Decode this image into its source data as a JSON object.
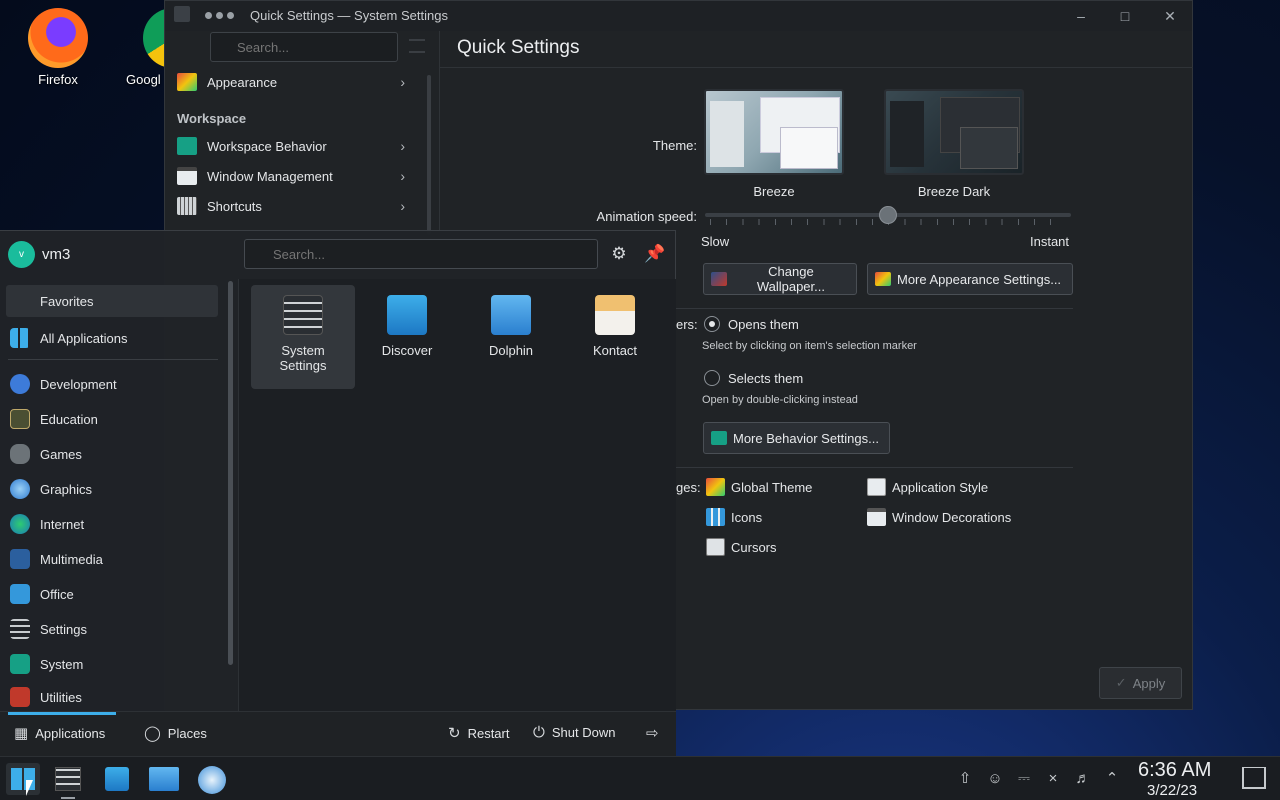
{
  "desktop": {
    "icons": [
      {
        "label": "Firefox"
      },
      {
        "label": "Googl"
      }
    ]
  },
  "system_settings": {
    "title": "Quick Settings — System Settings",
    "search_placeholder": "Search...",
    "sidebar": {
      "top_item": "Appearance",
      "section_workspace": "Workspace",
      "items": [
        "Workspace Behavior",
        "Window Management",
        "Shortcuts"
      ]
    },
    "page_title": "Quick Settings",
    "theme_label": "Theme:",
    "themes": [
      {
        "name": "Breeze"
      },
      {
        "name": "Breeze Dark"
      }
    ],
    "animation_label": "Animation speed:",
    "animation_min": "Slow",
    "animation_max": "Instant",
    "animation_value": 0.5,
    "change_wallpaper": "Change Wallpaper...",
    "more_appearance": "More Appearance Settings...",
    "clicking_label": "ers:",
    "opens_them": "Opens them",
    "opens_hint": "Select by clicking on item's selection marker",
    "selects_them": "Selects them",
    "selects_hint": "Open by double-clicking instead",
    "more_behavior": "More Behavior Settings...",
    "most_used_label": "ges:",
    "most_used": [
      "Global Theme",
      "Application Style",
      "Icons",
      "Window Decorations",
      "Cursors"
    ],
    "apply": "Apply"
  },
  "launcher": {
    "avatar_letter": "v",
    "user": "vm3",
    "search_placeholder": "Search...",
    "categories": [
      "Favorites",
      "All Applications",
      "Development",
      "Education",
      "Games",
      "Graphics",
      "Internet",
      "Multimedia",
      "Office",
      "Settings",
      "System",
      "Utilities"
    ],
    "apps": [
      {
        "line1": "System",
        "line2": "Settings"
      },
      {
        "line1": "Discover",
        "line2": ""
      },
      {
        "line1": "Dolphin",
        "line2": ""
      },
      {
        "line1": "Kontact",
        "line2": ""
      }
    ],
    "tabs": [
      "Applications",
      "Places"
    ],
    "restart": "Restart",
    "shutdown": "Shut Down"
  },
  "taskbar": {
    "time": "6:36 AM",
    "date": "3/22/23"
  },
  "colors": {
    "accent": "#3daee9",
    "window_bg": "#202326"
  }
}
